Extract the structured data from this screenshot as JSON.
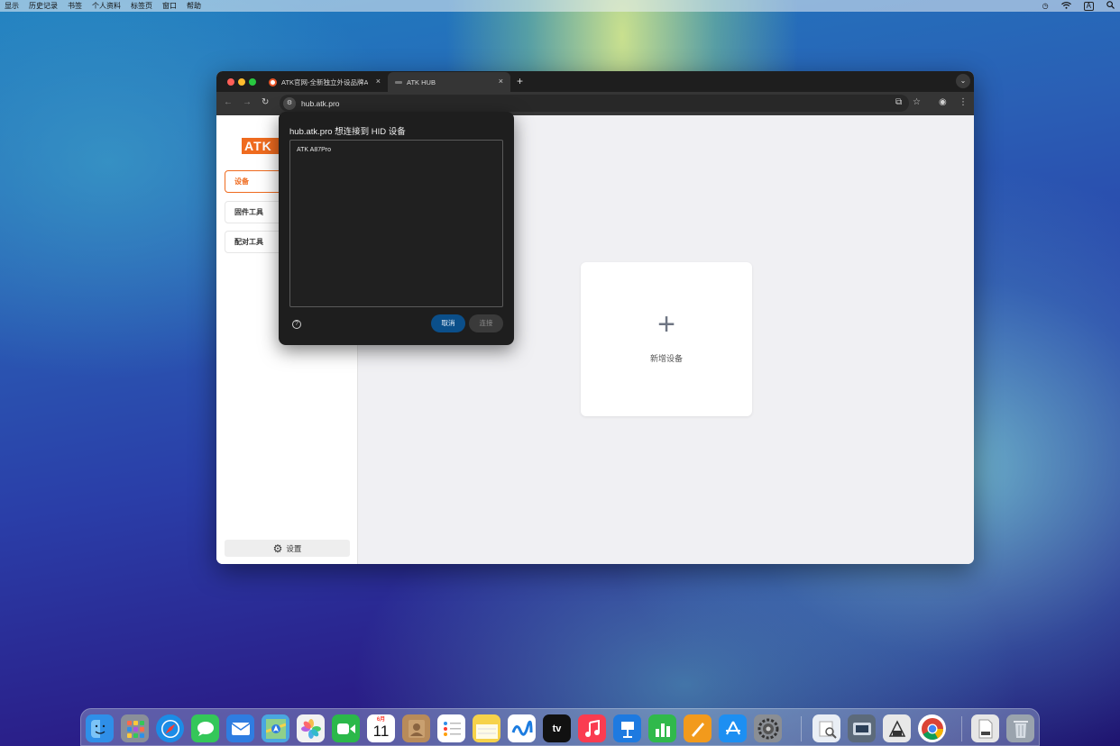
{
  "menubar": {
    "items": [
      "显示",
      "历史记录",
      "书签",
      "个人资料",
      "标签页",
      "窗口",
      "帮助"
    ],
    "status": {
      "input_indicator": "A"
    }
  },
  "browser": {
    "tabs": [
      {
        "title": "ATK官网-全新独立外设品牌ATK",
        "close": "×"
      },
      {
        "title": "ATK HUB",
        "close": "×"
      }
    ],
    "new_tab": "+",
    "url": "hub.atk.pro"
  },
  "page": {
    "logo": "ATK",
    "nav": [
      {
        "label": "设备",
        "active": true
      },
      {
        "label": "固件工具",
        "active": false
      },
      {
        "label": "配对工具",
        "active": false
      }
    ],
    "settings_label": "设置",
    "add_card": {
      "plus": "+",
      "label": "新增设备"
    }
  },
  "dialog": {
    "title": "hub.atk.pro 想连接到 HID 设备",
    "devices": [
      "ATK A87Pro"
    ],
    "help": "?",
    "cancel": "取消",
    "connect": "连接"
  },
  "dock": {
    "calendar_month": "6月",
    "calendar_day": "11",
    "tv_label": "tv",
    "colors": {
      "finder": "#2f8fe8",
      "launchpad": "#8a8f99",
      "safari": "#1c8ce6",
      "messages": "#34c759",
      "mail": "#2f7de1",
      "maps": "#4aa7e0",
      "photos": "#f2f2f2",
      "facetime": "#2bb84a",
      "calendar": "#ffffff",
      "contacts": "#b88b5a",
      "reminders": "#ffffff",
      "notes": "#f6d24a",
      "freeform": "#ffffff",
      "tv": "#111111",
      "music": "#fa3c50",
      "keynote": "#1e7ae0",
      "numbers": "#30b94b",
      "pages": "#f29a1c",
      "appstore": "#1d8ff2",
      "settings": "#8a8e94",
      "preview": "#e9eef5",
      "screenshot": "#5c6a7a",
      "utility": "#e8e8e8",
      "chrome": "#ffffff",
      "document": "#e6e6e6",
      "trash": "#9aa3ad"
    }
  }
}
